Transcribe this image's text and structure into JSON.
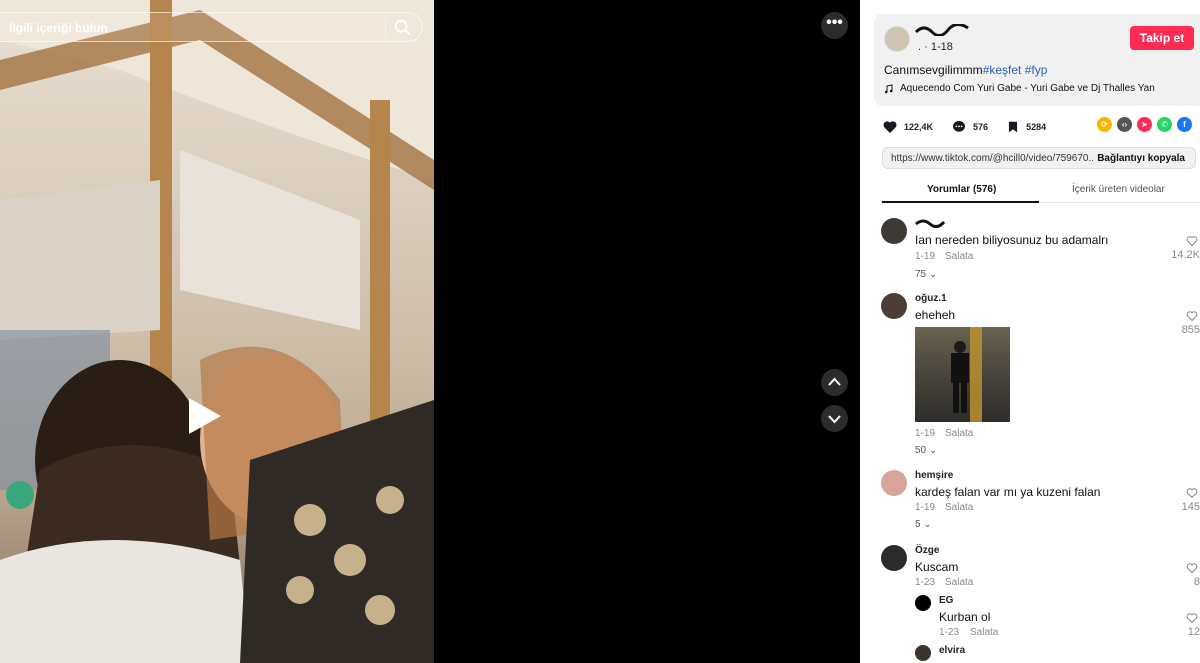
{
  "search": {
    "placeholder": "İlgili içeriği bulun"
  },
  "video": {
    "more_label": "•••"
  },
  "post": {
    "meta": ". · 1-18",
    "follow_label": "Takip et",
    "caption_text": "Canımsevgilimmm",
    "caption_tags": [
      "#keşfet",
      "#fyp"
    ],
    "music": "Aquecendo Com Yuri Gabe - Yuri Gabe ve Dj Thalles Yan"
  },
  "stats": {
    "likes": "122,4K",
    "comments": "576",
    "saves": "5284"
  },
  "link": {
    "url": "https://www.tiktok.com/@hcill0/video/759670...",
    "copy_label": "Bağlantıyı kopyala"
  },
  "tabs": {
    "comments": "Yorumlar (576)",
    "creator_videos": "İçerik üreten videolar"
  },
  "comments": [
    {
      "user": "",
      "text": "Ian nereden biliyosunuz bu adamalrı",
      "date": "1-19",
      "reply": "Salata",
      "more": "75",
      "likes": "14.2K"
    },
    {
      "user": "oğuz.1",
      "text": "eheheh",
      "date": "1-19",
      "reply": "Salata",
      "more": "50",
      "likes": "855"
    },
    {
      "user": "hemşire",
      "text": "kardeş falan var mı ya kuzeni falan",
      "date": "1-19",
      "reply": "Salata",
      "more": "5",
      "likes": "145"
    },
    {
      "user": "Özge",
      "text": "Kuscam",
      "date": "1-23",
      "reply": "Salata",
      "likes": "8"
    }
  ],
  "replies": [
    {
      "user": "EG",
      "text": "Kurban ol",
      "date": "1-23",
      "reply": "Salata",
      "likes": "12"
    },
    {
      "user": "elvira",
      "text": ""
    }
  ],
  "colors": {
    "accent": "#fe2c55",
    "tag": "#2b5db9"
  }
}
